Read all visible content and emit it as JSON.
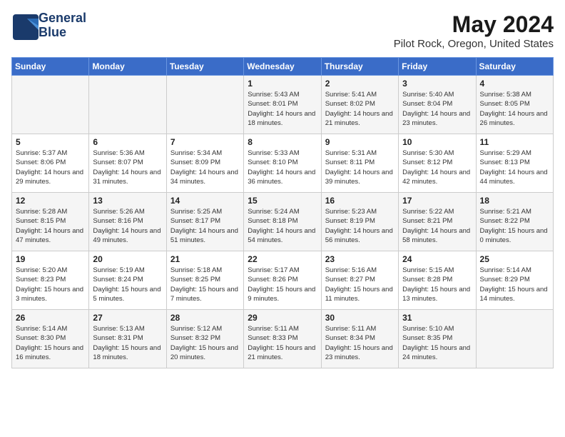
{
  "logo": {
    "line1": "General",
    "line2": "Blue"
  },
  "title": "May 2024",
  "subtitle": "Pilot Rock, Oregon, United States",
  "weekdays": [
    "Sunday",
    "Monday",
    "Tuesday",
    "Wednesday",
    "Thursday",
    "Friday",
    "Saturday"
  ],
  "weeks": [
    [
      {
        "day": "",
        "sunrise": "",
        "sunset": "",
        "daylight": ""
      },
      {
        "day": "",
        "sunrise": "",
        "sunset": "",
        "daylight": ""
      },
      {
        "day": "",
        "sunrise": "",
        "sunset": "",
        "daylight": ""
      },
      {
        "day": "1",
        "sunrise": "Sunrise: 5:43 AM",
        "sunset": "Sunset: 8:01 PM",
        "daylight": "Daylight: 14 hours and 18 minutes."
      },
      {
        "day": "2",
        "sunrise": "Sunrise: 5:41 AM",
        "sunset": "Sunset: 8:02 PM",
        "daylight": "Daylight: 14 hours and 21 minutes."
      },
      {
        "day": "3",
        "sunrise": "Sunrise: 5:40 AM",
        "sunset": "Sunset: 8:04 PM",
        "daylight": "Daylight: 14 hours and 23 minutes."
      },
      {
        "day": "4",
        "sunrise": "Sunrise: 5:38 AM",
        "sunset": "Sunset: 8:05 PM",
        "daylight": "Daylight: 14 hours and 26 minutes."
      }
    ],
    [
      {
        "day": "5",
        "sunrise": "Sunrise: 5:37 AM",
        "sunset": "Sunset: 8:06 PM",
        "daylight": "Daylight: 14 hours and 29 minutes."
      },
      {
        "day": "6",
        "sunrise": "Sunrise: 5:36 AM",
        "sunset": "Sunset: 8:07 PM",
        "daylight": "Daylight: 14 hours and 31 minutes."
      },
      {
        "day": "7",
        "sunrise": "Sunrise: 5:34 AM",
        "sunset": "Sunset: 8:09 PM",
        "daylight": "Daylight: 14 hours and 34 minutes."
      },
      {
        "day": "8",
        "sunrise": "Sunrise: 5:33 AM",
        "sunset": "Sunset: 8:10 PM",
        "daylight": "Daylight: 14 hours and 36 minutes."
      },
      {
        "day": "9",
        "sunrise": "Sunrise: 5:31 AM",
        "sunset": "Sunset: 8:11 PM",
        "daylight": "Daylight: 14 hours and 39 minutes."
      },
      {
        "day": "10",
        "sunrise": "Sunrise: 5:30 AM",
        "sunset": "Sunset: 8:12 PM",
        "daylight": "Daylight: 14 hours and 42 minutes."
      },
      {
        "day": "11",
        "sunrise": "Sunrise: 5:29 AM",
        "sunset": "Sunset: 8:13 PM",
        "daylight": "Daylight: 14 hours and 44 minutes."
      }
    ],
    [
      {
        "day": "12",
        "sunrise": "Sunrise: 5:28 AM",
        "sunset": "Sunset: 8:15 PM",
        "daylight": "Daylight: 14 hours and 47 minutes."
      },
      {
        "day": "13",
        "sunrise": "Sunrise: 5:26 AM",
        "sunset": "Sunset: 8:16 PM",
        "daylight": "Daylight: 14 hours and 49 minutes."
      },
      {
        "day": "14",
        "sunrise": "Sunrise: 5:25 AM",
        "sunset": "Sunset: 8:17 PM",
        "daylight": "Daylight: 14 hours and 51 minutes."
      },
      {
        "day": "15",
        "sunrise": "Sunrise: 5:24 AM",
        "sunset": "Sunset: 8:18 PM",
        "daylight": "Daylight: 14 hours and 54 minutes."
      },
      {
        "day": "16",
        "sunrise": "Sunrise: 5:23 AM",
        "sunset": "Sunset: 8:19 PM",
        "daylight": "Daylight: 14 hours and 56 minutes."
      },
      {
        "day": "17",
        "sunrise": "Sunrise: 5:22 AM",
        "sunset": "Sunset: 8:21 PM",
        "daylight": "Daylight: 14 hours and 58 minutes."
      },
      {
        "day": "18",
        "sunrise": "Sunrise: 5:21 AM",
        "sunset": "Sunset: 8:22 PM",
        "daylight": "Daylight: 15 hours and 0 minutes."
      }
    ],
    [
      {
        "day": "19",
        "sunrise": "Sunrise: 5:20 AM",
        "sunset": "Sunset: 8:23 PM",
        "daylight": "Daylight: 15 hours and 3 minutes."
      },
      {
        "day": "20",
        "sunrise": "Sunrise: 5:19 AM",
        "sunset": "Sunset: 8:24 PM",
        "daylight": "Daylight: 15 hours and 5 minutes."
      },
      {
        "day": "21",
        "sunrise": "Sunrise: 5:18 AM",
        "sunset": "Sunset: 8:25 PM",
        "daylight": "Daylight: 15 hours and 7 minutes."
      },
      {
        "day": "22",
        "sunrise": "Sunrise: 5:17 AM",
        "sunset": "Sunset: 8:26 PM",
        "daylight": "Daylight: 15 hours and 9 minutes."
      },
      {
        "day": "23",
        "sunrise": "Sunrise: 5:16 AM",
        "sunset": "Sunset: 8:27 PM",
        "daylight": "Daylight: 15 hours and 11 minutes."
      },
      {
        "day": "24",
        "sunrise": "Sunrise: 5:15 AM",
        "sunset": "Sunset: 8:28 PM",
        "daylight": "Daylight: 15 hours and 13 minutes."
      },
      {
        "day": "25",
        "sunrise": "Sunrise: 5:14 AM",
        "sunset": "Sunset: 8:29 PM",
        "daylight": "Daylight: 15 hours and 14 minutes."
      }
    ],
    [
      {
        "day": "26",
        "sunrise": "Sunrise: 5:14 AM",
        "sunset": "Sunset: 8:30 PM",
        "daylight": "Daylight: 15 hours and 16 minutes."
      },
      {
        "day": "27",
        "sunrise": "Sunrise: 5:13 AM",
        "sunset": "Sunset: 8:31 PM",
        "daylight": "Daylight: 15 hours and 18 minutes."
      },
      {
        "day": "28",
        "sunrise": "Sunrise: 5:12 AM",
        "sunset": "Sunset: 8:32 PM",
        "daylight": "Daylight: 15 hours and 20 minutes."
      },
      {
        "day": "29",
        "sunrise": "Sunrise: 5:11 AM",
        "sunset": "Sunset: 8:33 PM",
        "daylight": "Daylight: 15 hours and 21 minutes."
      },
      {
        "day": "30",
        "sunrise": "Sunrise: 5:11 AM",
        "sunset": "Sunset: 8:34 PM",
        "daylight": "Daylight: 15 hours and 23 minutes."
      },
      {
        "day": "31",
        "sunrise": "Sunrise: 5:10 AM",
        "sunset": "Sunset: 8:35 PM",
        "daylight": "Daylight: 15 hours and 24 minutes."
      },
      {
        "day": "",
        "sunrise": "",
        "sunset": "",
        "daylight": ""
      }
    ]
  ]
}
